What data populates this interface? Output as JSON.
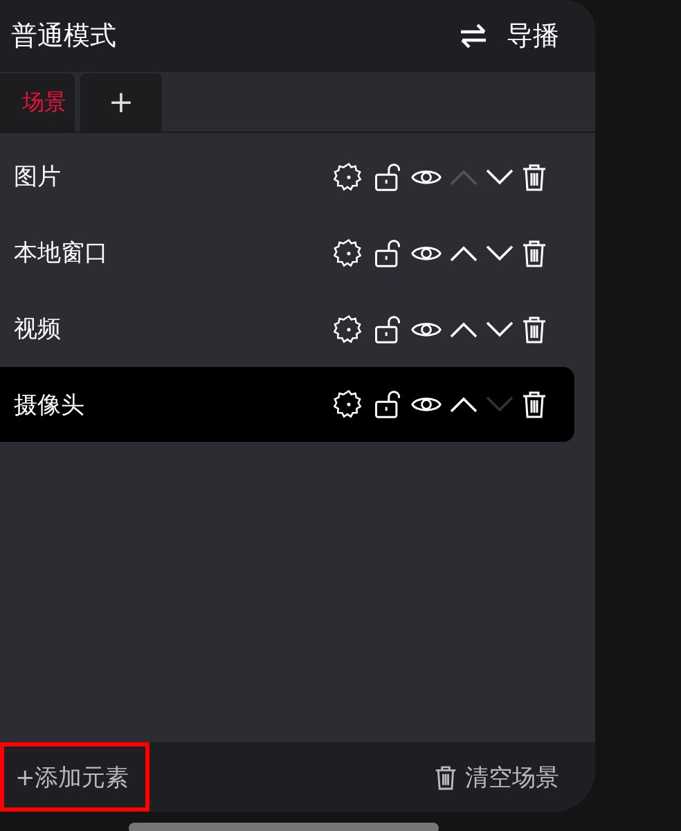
{
  "header": {
    "title": "普通模式",
    "switch_label": "导播"
  },
  "tabs": [
    {
      "label": "场景",
      "selected": true
    },
    {
      "label": "+",
      "selected": false
    }
  ],
  "elements": [
    {
      "name": "图片",
      "selected": false,
      "up_disabled": true,
      "down_disabled": false
    },
    {
      "name": "本地窗口",
      "selected": false,
      "up_disabled": false,
      "down_disabled": false
    },
    {
      "name": "视频",
      "selected": false,
      "up_disabled": false,
      "down_disabled": false
    },
    {
      "name": "摄像头",
      "selected": true,
      "up_disabled": false,
      "down_disabled": true
    }
  ],
  "footer": {
    "add_label": "+添加元素",
    "add_highlighted": true,
    "clear_label": "清空场景"
  }
}
